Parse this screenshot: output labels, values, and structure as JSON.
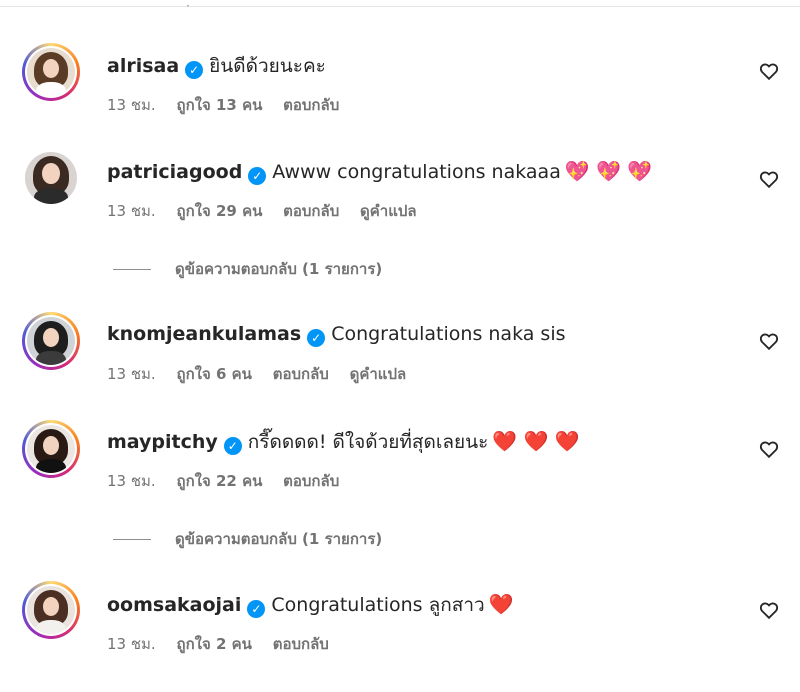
{
  "comments": [
    {
      "username": "alrisaa",
      "text": "ยินดีด้วยนะคะ",
      "emojis": "",
      "time": "13 ชม.",
      "likes": "ถูกใจ 13 คน",
      "reply": "ตอบกลับ",
      "translate": ""
    },
    {
      "username": "patriciagood",
      "text": "Awww congratulations nakaaa",
      "emojis": "💖 💖 💖",
      "time": "13 ชม.",
      "likes": "ถูกใจ 29 คน",
      "reply": "ตอบกลับ",
      "translate": "ดูคำแปล"
    },
    {
      "username": "knomjeankulamas",
      "text": "Congratulations naka sis",
      "emojis": "",
      "time": "13 ชม.",
      "likes": "ถูกใจ 6 คน",
      "reply": "ตอบกลับ",
      "translate": "ดูคำแปล"
    },
    {
      "username": "maypitchy",
      "text": "กรี๊ดดดด! ดีใจด้วยที่สุดเลยนะ",
      "emojis": "❤️ ❤️ ❤️",
      "time": "13 ชม.",
      "likes": "ถูกใจ 22 คน",
      "reply": "ตอบกลับ",
      "translate": ""
    },
    {
      "username": "oomsakaojai",
      "text": "Congratulations ลูกสาว",
      "emojis": "❤️",
      "time": "13 ชม.",
      "likes": "ถูกใจ 2 คน",
      "reply": "ตอบกลับ",
      "translate": ""
    }
  ],
  "view_replies": [
    "ดูข้อความตอบกลับ (1 รายการ)",
    "ดูข้อความตอบกลับ (1 รายการ)"
  ],
  "colors": {
    "accent_verified": "#0095f6",
    "secondary_text": "#737373",
    "primary_text": "#262626"
  },
  "icons": {
    "verified": "verified-badge-icon",
    "like": "heart-outline-icon"
  }
}
